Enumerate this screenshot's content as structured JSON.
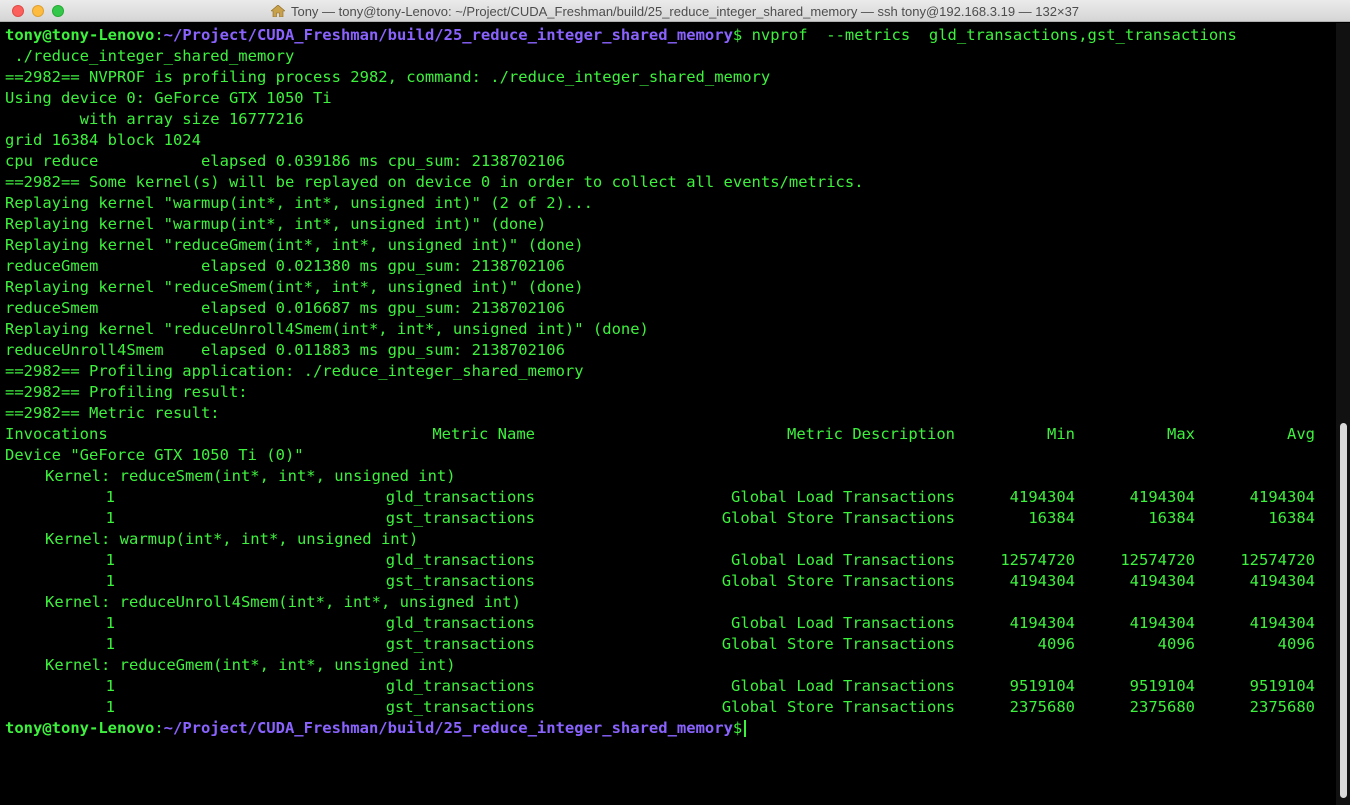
{
  "window": {
    "title": "Tony — tony@tony-Lenovo: ~/Project/CUDA_Freshman/build/25_reduce_integer_shared_memory — ssh tony@192.168.3.19 — 132×37",
    "icon": "home-icon"
  },
  "colors": {
    "text": "#3df23d",
    "path": "#8a63ff",
    "background": "#000000"
  },
  "prompt": {
    "user": "tony@tony-Lenovo",
    "path": "~/Project/CUDA_Freshman/build/25_reduce_integer_shared_memory",
    "symbol": "$",
    "command": " nvprof  --metrics  gld_transactions,gst_transactions",
    "command_cont": " ./reduce_integer_shared_memory"
  },
  "output": [
    "==2982== NVPROF is profiling process 2982, command: ./reduce_integer_shared_memory",
    "Using device 0: GeForce GTX 1050 Ti",
    "        with array size 16777216",
    "grid 16384 block 1024",
    "cpu reduce           elapsed 0.039186 ms cpu_sum: 2138702106",
    "==2982== Some kernel(s) will be replayed on device 0 in order to collect all events/metrics.",
    "Replaying kernel \"warmup(int*, int*, unsigned int)\" (2 of 2)...",
    "Replaying kernel \"warmup(int*, int*, unsigned int)\" (done)",
    "Replaying kernel \"reduceGmem(int*, int*, unsigned int)\" (done)",
    "reduceGmem           elapsed 0.021380 ms gpu_sum: 2138702106",
    "Replaying kernel \"reduceSmem(int*, int*, unsigned int)\" (done)",
    "reduceSmem           elapsed 0.016687 ms gpu_sum: 2138702106",
    "Replaying kernel \"reduceUnroll4Smem(int*, int*, unsigned int)\" (done)",
    "reduceUnroll4Smem    elapsed 0.011883 ms gpu_sum: 2138702106",
    "==2982== Profiling application: ./reduce_integer_shared_memory",
    "==2982== Profiling result:",
    "==2982== Metric result:"
  ],
  "table": {
    "headers": {
      "invocations": "Invocations",
      "metric_name": "Metric Name",
      "metric_description": "Metric Description",
      "min": "Min",
      "max": "Max",
      "avg": "Avg"
    },
    "device": "Device \"GeForce GTX 1050 Ti (0)\"",
    "kernels": [
      {
        "label": "Kernel: reduceSmem(int*, int*, unsigned int)",
        "rows": [
          {
            "inv": "1",
            "name": "gld_transactions",
            "desc": "Global Load Transactions",
            "min": "4194304",
            "max": "4194304",
            "avg": "4194304"
          },
          {
            "inv": "1",
            "name": "gst_transactions",
            "desc": "Global Store Transactions",
            "min": "16384",
            "max": "16384",
            "avg": "16384"
          }
        ]
      },
      {
        "label": "Kernel: warmup(int*, int*, unsigned int)",
        "rows": [
          {
            "inv": "1",
            "name": "gld_transactions",
            "desc": "Global Load Transactions",
            "min": "12574720",
            "max": "12574720",
            "avg": "12574720"
          },
          {
            "inv": "1",
            "name": "gst_transactions",
            "desc": "Global Store Transactions",
            "min": "4194304",
            "max": "4194304",
            "avg": "4194304"
          }
        ]
      },
      {
        "label": "Kernel: reduceUnroll4Smem(int*, int*, unsigned int)",
        "rows": [
          {
            "inv": "1",
            "name": "gld_transactions",
            "desc": "Global Load Transactions",
            "min": "4194304",
            "max": "4194304",
            "avg": "4194304"
          },
          {
            "inv": "1",
            "name": "gst_transactions",
            "desc": "Global Store Transactions",
            "min": "4096",
            "max": "4096",
            "avg": "4096"
          }
        ]
      },
      {
        "label": "Kernel: reduceGmem(int*, int*, unsigned int)",
        "rows": [
          {
            "inv": "1",
            "name": "gld_transactions",
            "desc": "Global Load Transactions",
            "min": "9519104",
            "max": "9519104",
            "avg": "9519104"
          },
          {
            "inv": "1",
            "name": "gst_transactions",
            "desc": "Global Store Transactions",
            "min": "2375680",
            "max": "2375680",
            "avg": "2375680"
          }
        ]
      }
    ]
  }
}
